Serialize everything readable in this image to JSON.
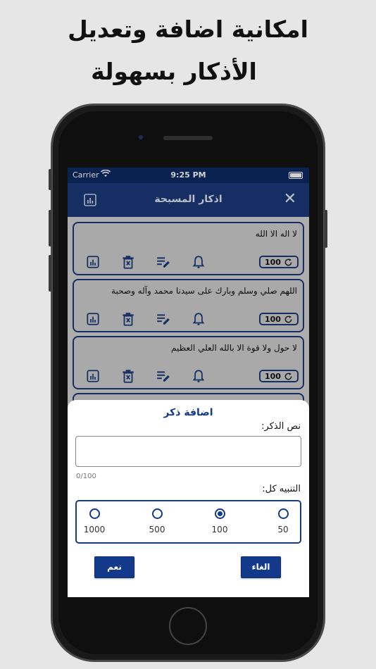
{
  "promo": {
    "line1": "امكانية اضافة وتعديل",
    "line2": "الأذكار بسهولة"
  },
  "statusbar": {
    "carrier": "Carrier",
    "time": "9:25 PM"
  },
  "navbar": {
    "title": "اذكار المسبحة"
  },
  "list": {
    "items": [
      {
        "text": "لا اله الا الله",
        "count": "100"
      },
      {
        "text": "اللهم صلي وسلم وبارك على سيدنا محمد وآله وصحبة",
        "count": "100"
      },
      {
        "text": "لا حول ولا قوة الا بالله العلي العظيم",
        "count": "100"
      }
    ]
  },
  "sheet": {
    "title": "اضافة ذكر",
    "text_label": "نص الذكر:",
    "input_value": "",
    "char_counter": "0/100",
    "alert_label": "التنبيه كل:",
    "options": [
      "1000",
      "500",
      "100",
      "50"
    ],
    "selected": "100",
    "confirm_label": "نعم",
    "cancel_label": "الغاء"
  },
  "colors": {
    "primary": "#13398a",
    "navbar": "#1a3a7a",
    "statusbar": "#0b2a62"
  }
}
